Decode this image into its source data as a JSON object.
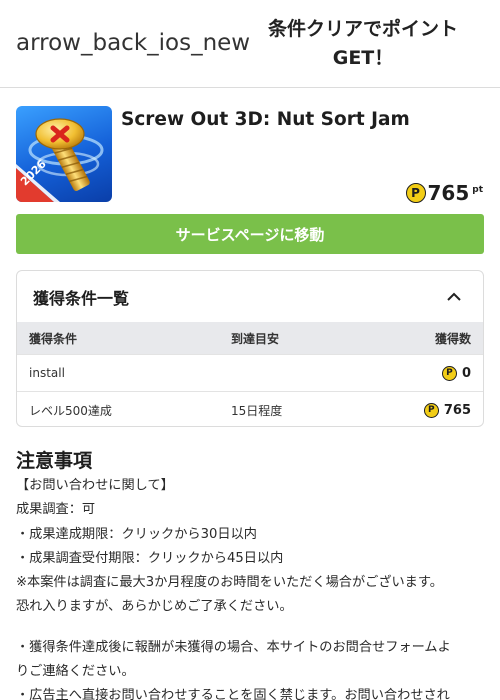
{
  "header": {
    "back_label": "arrow_back_ios_new",
    "title_line1": "条件クリアでポイント",
    "title_line2": "GET！"
  },
  "app": {
    "name": "Screw Out 3D: Nut Sort Jam",
    "icon_badge": "2026",
    "points_value": "765",
    "points_unit": "pt",
    "coin_letter": "P"
  },
  "service_button_label": "サービスページに移動",
  "conditions": {
    "title": "獲得条件一覧",
    "columns": [
      "獲得条件",
      "到達目安",
      "獲得数"
    ],
    "rows": [
      {
        "condition": "install",
        "target": "",
        "points": "0"
      },
      {
        "condition": "レベル500達成",
        "target": "15日程度",
        "points": "765"
      }
    ]
  },
  "notes": {
    "title": "注意事項",
    "lines": [
      "【お問い合わせに関して】",
      "成果調査：可",
      "・成果達成期限：クリックから30日以内",
      "・成果調査受付期限：クリックから45日以内",
      "※本案件は調査に最大3か月程度のお時間をいただく場合がございます。",
      "恐れ入りますが、あらかじめご了承ください。",
      "",
      "・獲得条件達成後に報酬が未獲得の場合、本サイトのお問合せフォームよ",
      "りご連絡ください。",
      "・広告主へ直接お問い合わせすることを固く禁じます。お問い合わせされ"
    ]
  },
  "colors": {
    "accent_green": "#7ac04a",
    "coin_yellow": "#f2cd16",
    "table_header_bg": "#e8e9ec"
  },
  "icons": {
    "back": "arrow-back-icon",
    "collapse": "chevron-up-icon",
    "coin": "point-coin-icon"
  }
}
